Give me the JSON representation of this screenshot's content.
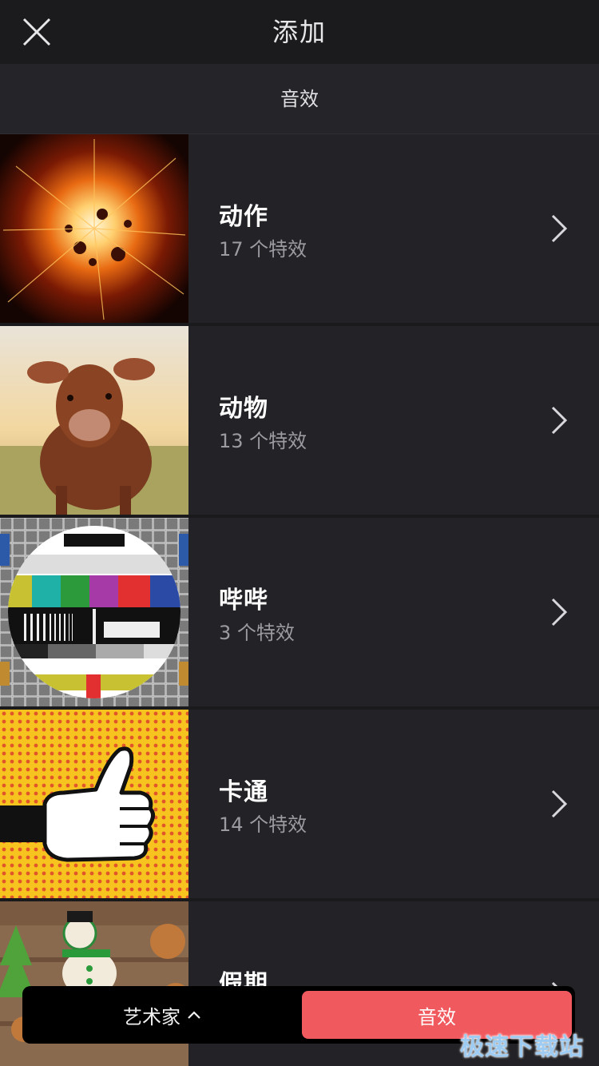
{
  "header": {
    "title": "添加"
  },
  "tabs": {
    "active_label": "音效"
  },
  "categories": [
    {
      "title": "动作",
      "subtitle": "17 个特效",
      "thumb_icon": "explosion-image"
    },
    {
      "title": "动物",
      "subtitle": "13 个特效",
      "thumb_icon": "cow-image"
    },
    {
      "title": "哔哔",
      "subtitle": "3 个特效",
      "thumb_icon": "tv-test-pattern-image"
    },
    {
      "title": "卡通",
      "subtitle": "14 个特效",
      "thumb_icon": "thumbs-up-cartoon-image"
    },
    {
      "title": "假期",
      "subtitle": "",
      "thumb_icon": "holiday-cookies-image"
    }
  ],
  "bottom": {
    "artist_label": "艺术家",
    "sfx_label": "音效"
  },
  "watermark": "极速下载站",
  "colors": {
    "accent": "#f05a5f",
    "background": "#222226",
    "header": "#1b1b1e"
  }
}
